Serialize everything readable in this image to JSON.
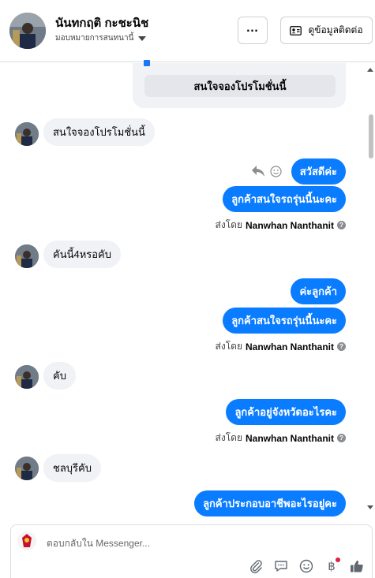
{
  "header": {
    "name": "นันทกฤติ กะชะนิช",
    "assignee": "มอบหมายการสนทนานี้",
    "contact_button": "ดูข้อมูลติดต่อ"
  },
  "promo": {
    "button_label": "สนใจจองโปรโมชั่นนี้"
  },
  "messages": [
    {
      "direction": "in",
      "text": "สนใจจองโปรโมชั่นนี้"
    },
    {
      "direction": "out",
      "text": "สวัสดีค่ะ"
    },
    {
      "direction": "out",
      "text": "ลูกค้าสนใจรถรุ่นนี้นะคะ"
    },
    {
      "direction": "meta",
      "prefix": "ส่งโดย",
      "sender": "Nanwhan Nanthanit"
    },
    {
      "direction": "in",
      "text": "คันนี้4หรอคับ"
    },
    {
      "direction": "out",
      "text": "ค่ะลูกค้า"
    },
    {
      "direction": "out",
      "text": "ลูกค้าสนใจรถรุ่นนี้นะคะ"
    },
    {
      "direction": "meta",
      "prefix": "ส่งโดย",
      "sender": "Nanwhan Nanthanit"
    },
    {
      "direction": "in",
      "text": "คับ"
    },
    {
      "direction": "out",
      "text": "ลูกค้าอยู่จังหวัดอะไรคะ"
    },
    {
      "direction": "meta",
      "prefix": "ส่งโดย",
      "sender": "Nanwhan Nanthanit"
    },
    {
      "direction": "in",
      "text": "ชลบุรีคับ"
    },
    {
      "direction": "out",
      "text": "ลูกค้าประกอบอาชีพอะไรอยู่คะ"
    }
  ],
  "composer": {
    "placeholder": "ตอบกลับใน Messenger..."
  },
  "colors": {
    "accent": "#0a7cff",
    "incoming_bubble": "#f0f2f5",
    "notification": "#e41e3f"
  },
  "icons": [
    "more-icon",
    "contact-card-icon",
    "reply-icon",
    "emoji-icon",
    "attach-icon",
    "saved-replies-icon",
    "emoji-icon",
    "baht-icon",
    "like-icon",
    "info-icon"
  ]
}
